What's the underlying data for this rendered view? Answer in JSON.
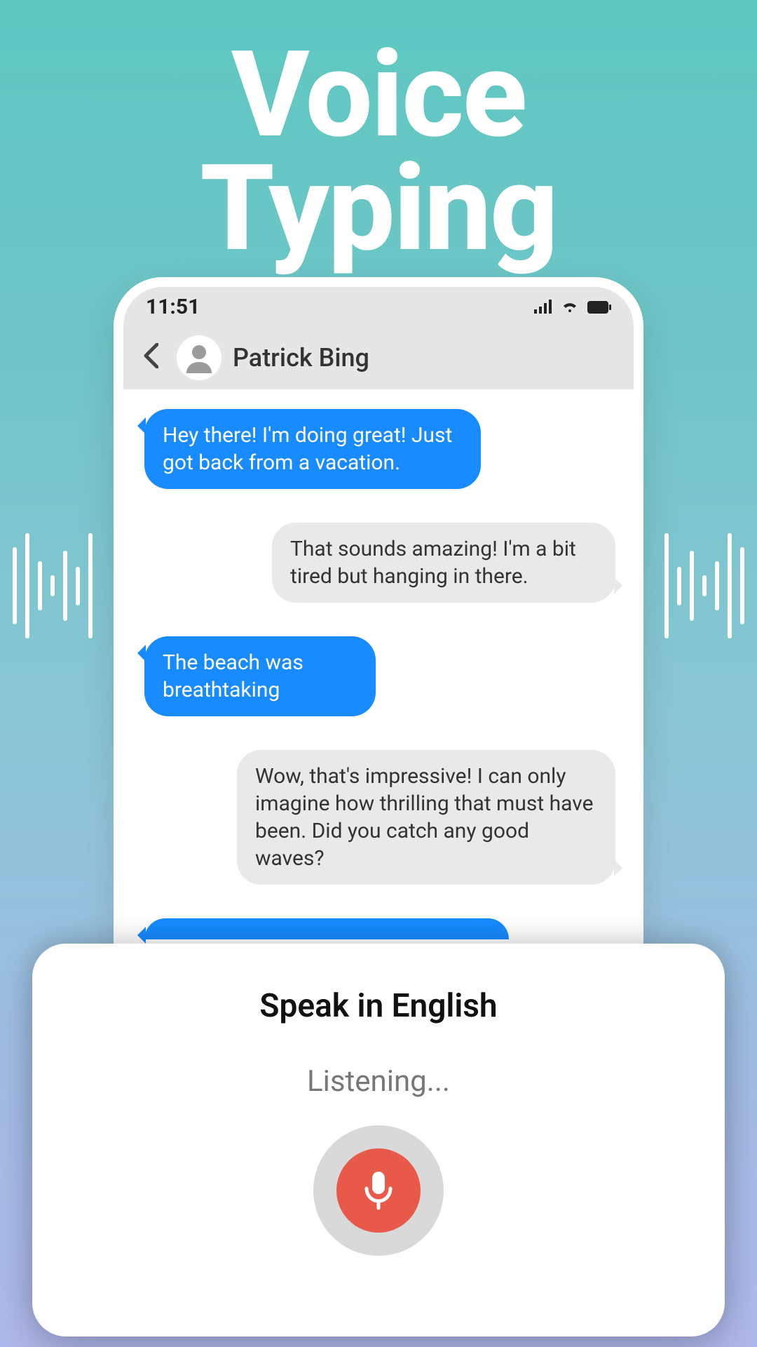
{
  "promo": {
    "line1": "Voice",
    "line2": "Typing"
  },
  "status": {
    "time": "11:51"
  },
  "header": {
    "contact_name": "Patrick Bing"
  },
  "messages": [
    {
      "direction": "out",
      "text": "Hey there! I'm doing great! Just got back from a vacation."
    },
    {
      "direction": "in",
      "text": "That sounds amazing! I'm a bit tired but hanging in there."
    },
    {
      "direction": "out",
      "text": "The beach was breathtaking"
    },
    {
      "direction": "in",
      "text": "Wow, that's impressive! I can only imagine how thrilling that must have been. Did you catch any good waves?"
    }
  ],
  "speak": {
    "title": "Speak in English",
    "status": "Listening..."
  },
  "icons": {
    "back": "chevron-left-icon",
    "avatar": "person-icon",
    "signal": "cell-signal-icon",
    "wifi": "wifi-icon",
    "battery": "battery-icon",
    "mic": "microphone-icon"
  }
}
